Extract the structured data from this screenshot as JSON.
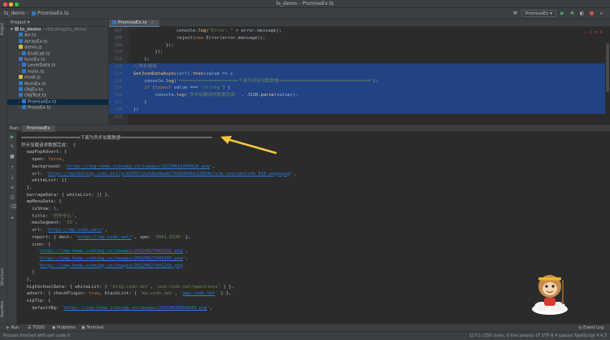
{
  "window": {
    "app_name": "ts_demo",
    "title": "ts_demo – PromiseEx.ts"
  },
  "nav": {
    "breadcrumb_project": "ts_demo",
    "breadcrumb_file": "PromiseEx.ts",
    "run_config": "PromiseEx"
  },
  "left_strip": {
    "project_tab": "Project",
    "structure_tab": "Structure",
    "favorites_tab": "Favorites"
  },
  "project_panel": {
    "title": "Project",
    "root": {
      "name": "ts_demo",
      "path": "~/Desktop/ts_demo"
    },
    "files": [
      "Arr.ts",
      "ArrayEx.ts",
      "demo.js",
      "EndCall.ts",
      "funcEx.ts",
      "LevelData.ts",
      "main.ts",
      "modi.js",
      "NumEx.ts",
      "ObjEx.ts",
      "ObjTest.ts",
      "PromiseEx.ts",
      "ProxyEx.ts"
    ]
  },
  "editor": {
    "tab": "PromiseEx.ts",
    "error_indicator": "⚠ 2  ✖ 4",
    "lines": [
      {
        "n": "107",
        "parts": [
          [
            "",
            "                console."
          ],
          [
            "fn",
            "log"
          ],
          [
            "",
            "("
          ],
          [
            "str",
            "\"Error: \""
          ],
          [
            "",
            " + error.message);"
          ]
        ]
      },
      {
        "n": "108",
        "parts": [
          [
            "",
            "                reject("
          ],
          [
            "kw",
            "new "
          ],
          [
            "",
            "Error(error.message));"
          ]
        ]
      },
      {
        "n": "109",
        "parts": [
          [
            "",
            "            });"
          ]
        ]
      },
      {
        "n": "110",
        "parts": [
          [
            "",
            "        });"
          ]
        ]
      },
      {
        "n": "111",
        "parts": [
          [
            "",
            "    };"
          ]
        ]
      },
      {
        "n": "112",
        "parts": [
          [
            "cm",
            "//异步调用"
          ]
        ]
      },
      {
        "n": "113",
        "parts": [
          [
            "fn",
            "GetJsonDataAsync"
          ],
          [
            "",
            "(url)."
          ],
          [
            "fn",
            "then"
          ],
          [
            "",
            "(value => {"
          ]
        ]
      },
      {
        "n": "114",
        "parts": [
          [
            "",
            "    console."
          ],
          [
            "fn",
            "log"
          ],
          [
            "",
            "("
          ],
          [
            "str",
            "\"======================下面为异步加载数据==================================\""
          ],
          [
            "",
            ");"
          ]
        ]
      },
      {
        "n": "115",
        "parts": [
          [
            "",
            "    "
          ],
          [
            "kw",
            "if "
          ],
          [
            "",
            "("
          ],
          [
            "kw",
            "typeof "
          ],
          [
            "",
            "value === "
          ],
          [
            "str",
            "\"string\""
          ],
          [
            "",
            ") {"
          ]
        ]
      },
      {
        "n": "116",
        "parts": [
          [
            "",
            "        console."
          ],
          [
            "fn",
            "log"
          ],
          [
            "",
            "("
          ],
          [
            "str",
            "'异步加载请求数据完成：'"
          ],
          [
            "",
            ", JSON."
          ],
          [
            "fn",
            "parse"
          ],
          [
            "",
            "(value));"
          ]
        ]
      },
      {
        "n": "117",
        "parts": [
          [
            "",
            "    }"
          ]
        ]
      },
      {
        "n": "118",
        "parts": [
          [
            "",
            "})"
          ]
        ]
      },
      {
        "n": "119",
        "parts": [
          [
            "",
            ""
          ]
        ]
      }
    ],
    "selected_lines": [
      5,
      6,
      7,
      8,
      9,
      10,
      11
    ]
  },
  "run_panel": {
    "label": "Run:",
    "tab": "PromiseEx"
  },
  "console": {
    "lines": [
      [
        [
          "",
          "======================下面为异步加载数据=================================="
        ]
      ],
      [
        [
          "",
          "异步加载请求数据完成： {"
        ]
      ],
      [
        [
          "",
          "  wapPopAdvert: {"
        ]
      ],
      [
        [
          "",
          "    open: "
        ],
        [
          "bool",
          "false"
        ],
        [
          "",
          ","
        ]
      ],
      [
        [
          "",
          "    background: "
        ],
        [
          "str",
          "'"
        ],
        [
          "url",
          "https://img-home.csdnimg.cn/images/20210615094826.png"
        ],
        [
          "str",
          "'"
        ],
        [
          "",
          ","
        ]
      ],
      [
        [
          "",
          "    url: "
        ],
        [
          "str",
          "'"
        ],
        [
          "url",
          "https://marketing.csdn.net/p/a594f12e0dbe4ae827b58484b622094b?utm_source=csdn_618_wappopup"
        ],
        [
          "str",
          "'"
        ],
        [
          "",
          ","
        ]
      ],
      [
        [
          "",
          "    whiteList: []"
        ]
      ],
      [
        [
          "",
          "  },"
        ]
      ],
      [
        [
          "",
          "  barrageData: { whiteList: [] },"
        ]
      ],
      [
        [
          "",
          "  mpMenuData: {"
        ]
      ],
      [
        [
          "",
          "    isShow: "
        ],
        [
          "num",
          "1"
        ],
        [
          "",
          ","
        ]
      ],
      [
        [
          "",
          "    title: "
        ],
        [
          "str",
          "'创作中心'"
        ],
        [
          "",
          ","
        ]
      ],
      [
        [
          "",
          "    maxSegment: "
        ],
        [
          "str",
          "'15'"
        ],
        [
          "",
          ","
        ]
      ],
      [
        [
          "",
          "    url: "
        ],
        [
          "str",
          "'"
        ],
        [
          "url",
          "https://mp.csdn.net/"
        ],
        [
          "str",
          "'"
        ],
        [
          "",
          ","
        ]
      ],
      [
        [
          "",
          "    report: { dest: "
        ],
        [
          "str",
          "'"
        ],
        [
          "url",
          "https://mp.csdn.net/"
        ],
        [
          "str",
          "'"
        ],
        [
          "",
          ", spm: "
        ],
        [
          "str",
          "'3001.8539'"
        ],
        [
          "",
          " },"
        ]
      ],
      [
        [
          "",
          "    icon: ["
        ]
      ],
      [
        [
          "",
          "      "
        ],
        [
          "str",
          "'"
        ],
        [
          "url",
          "https://img-home.csdnimg.cn/images/20220627041202.png"
        ],
        [
          "str",
          "'"
        ],
        [
          "",
          ","
        ]
      ],
      [
        [
          "",
          "      "
        ],
        [
          "str",
          "'"
        ],
        [
          "url",
          "https://img-home.csdnimg.cn/images/20220627041202.png"
        ],
        [
          "str",
          "'"
        ],
        [
          "",
          ","
        ]
      ],
      [
        [
          "",
          "      "
        ],
        [
          "str",
          "'"
        ],
        [
          "url",
          "https://img-home.csdnimg.cn/images/20220627041202.png"
        ],
        [
          "str",
          "'"
        ]
      ],
      [
        [
          "",
          "    ]"
        ]
      ],
      [
        [
          "",
          "  },"
        ]
      ],
      [
        [
          "",
          "  highSchoolData: { whiteList: [ "
        ],
        [
          "str",
          "'blog.csdn.net'"
        ],
        [
          "",
          ", "
        ],
        [
          "str",
          "'ask.csdn.net/questions'"
        ],
        [
          "",
          " ] },"
        ]
      ],
      [
        [
          "",
          "  advert: { checkPlugin: "
        ],
        [
          "bool",
          "true"
        ],
        [
          "",
          ", blackList: [ "
        ],
        [
          "str",
          "'mp.csdn.net'"
        ],
        [
          "",
          ", "
        ],
        [
          "str",
          "'"
        ],
        [
          "url",
          "www.csdn.net"
        ],
        [
          "str",
          "'"
        ],
        [
          "",
          " ] },"
        ]
      ],
      [
        [
          "",
          "  vipTip: {"
        ]
      ],
      [
        [
          "",
          "    defaultBg: "
        ],
        [
          "str",
          "'"
        ],
        [
          "url",
          "https://img-home.csdnimg.cn/images/20210826050049.png"
        ],
        [
          "str",
          "'"
        ],
        [
          "",
          ","
        ]
      ]
    ]
  },
  "tool_tabs": {
    "run": "Run",
    "todo": "TODO",
    "problems": "Problems",
    "terminal": "Terminal",
    "event_log": "Event Log"
  },
  "status": {
    "left": "Process finished with exit code 0",
    "right": "117:1 (250 chars, 6 line breaks)   LF   UTF-8   4 spaces   TypeScript 4.4.3"
  },
  "colors": {
    "selection": "#214283",
    "arrow": "#f5c542",
    "accent": "#4a88c7"
  }
}
